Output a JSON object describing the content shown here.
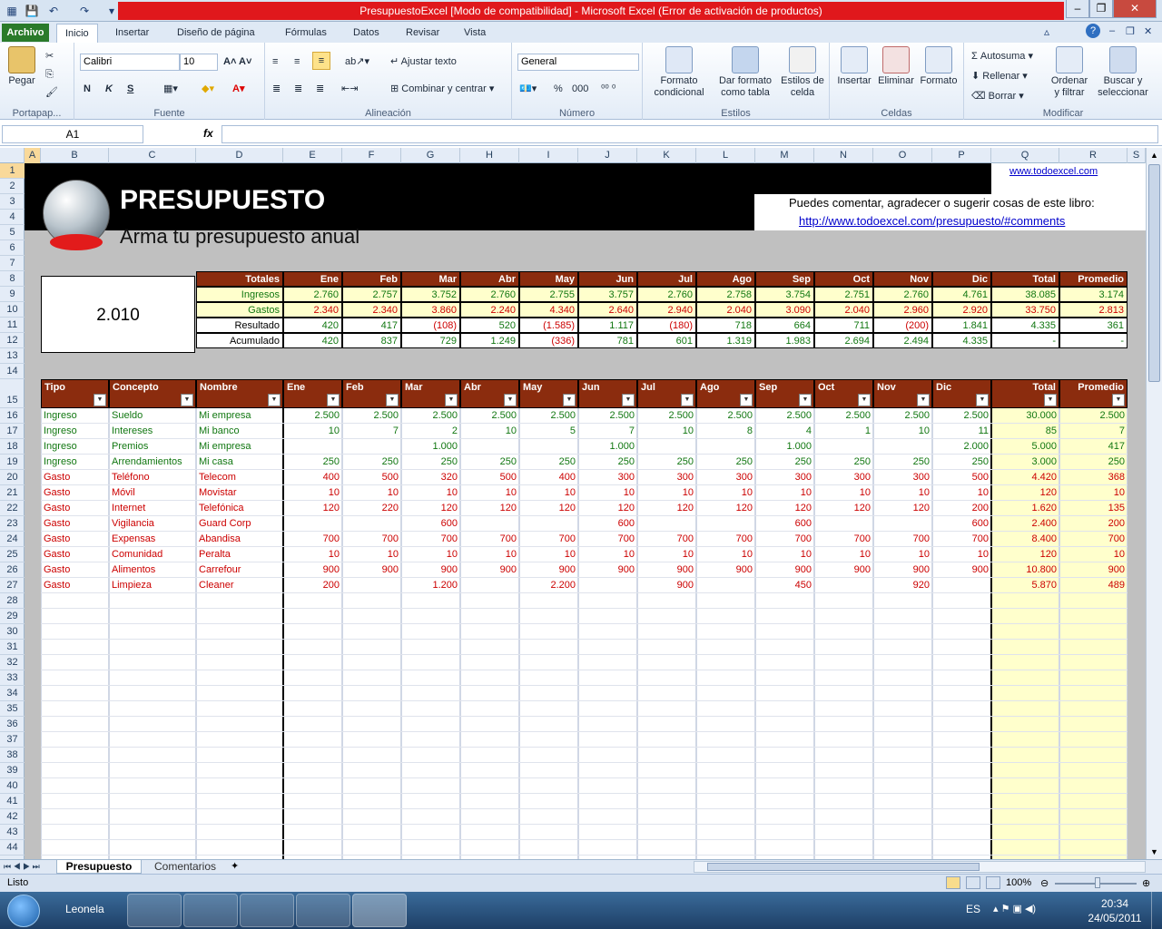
{
  "window": {
    "title": "PresupuestoExcel  [Modo de compatibilidad]  -  Microsoft Excel (Error de activación de productos)"
  },
  "tabs": {
    "archivo": "Archivo",
    "items": [
      "Inicio",
      "Insertar",
      "Diseño de página",
      "Fórmulas",
      "Datos",
      "Revisar",
      "Vista"
    ]
  },
  "ribbon": {
    "portapapeles": {
      "label": "Portapap...",
      "pegar": "Pegar"
    },
    "fuente": {
      "label": "Fuente",
      "font": "Calibri",
      "size": "10",
      "bold": "N",
      "italic": "K",
      "underline": "S"
    },
    "alineacion": {
      "label": "Alineación",
      "wrap": "Ajustar texto",
      "merge": "Combinar y centrar"
    },
    "numero": {
      "label": "Número",
      "format": "General",
      "percent": "%",
      "thousands": "000"
    },
    "estilos": {
      "label": "Estilos",
      "cond1": "Formato",
      "cond2": "condicional",
      "table1": "Dar formato",
      "table2": "como tabla",
      "cell1": "Estilos de",
      "cell2": "celda"
    },
    "celdas": {
      "label": "Celdas",
      "insert": "Insertar",
      "delete": "Eliminar",
      "format": "Formato"
    },
    "modificar": {
      "label": "Modificar",
      "autosum": "Autosuma",
      "fill": "Rellenar",
      "clear": "Borrar",
      "sort1": "Ordenar",
      "sort2": "y filtrar",
      "find1": "Buscar y",
      "find2": "seleccionar"
    }
  },
  "formula": {
    "namebox": "A1",
    "fx": "fx",
    "value": ""
  },
  "columns": [
    "A",
    "B",
    "C",
    "D",
    "E",
    "F",
    "G",
    "H",
    "I",
    "J",
    "K",
    "L",
    "M",
    "N",
    "O",
    "P",
    "Q",
    "R",
    "S"
  ],
  "rows": [
    "1",
    "2",
    "3",
    "4",
    "5",
    "6",
    "7",
    "8",
    "9",
    "10",
    "11",
    "12",
    "13",
    "14",
    "15",
    "16",
    "17",
    "18",
    "19",
    "20",
    "21",
    "22",
    "23",
    "24",
    "25",
    "26",
    "27",
    "28",
    "29",
    "30",
    "31",
    "32",
    "33",
    "34",
    "35",
    "36",
    "37",
    "38",
    "39",
    "40",
    "41",
    "42",
    "43",
    "44"
  ],
  "sheet": {
    "title": "PRESUPUESTO",
    "subtitle": "Arma tu presupuesto anual",
    "site": "www.todoexcel.com",
    "comment": "Puedes comentar, agradecer o sugerir cosas de este libro:",
    "comment_link": "http://www.todoexcel.com/presupuesto/#comments",
    "year": "2.010",
    "summary_headers": [
      "Totales",
      "Ene",
      "Feb",
      "Mar",
      "Abr",
      "May",
      "Jun",
      "Jul",
      "Ago",
      "Sep",
      "Oct",
      "Nov",
      "Dic",
      "Total",
      "Promedio"
    ],
    "summary_rows": [
      [
        "Ingresos",
        "2.760",
        "2.757",
        "3.752",
        "2.760",
        "2.755",
        "3.757",
        "2.760",
        "2.758",
        "3.754",
        "2.751",
        "2.760",
        "4.761",
        "38.085",
        "3.174"
      ],
      [
        "Gastos",
        "2.340",
        "2.340",
        "3.860",
        "2.240",
        "4.340",
        "2.640",
        "2.940",
        "2.040",
        "3.090",
        "2.040",
        "2.960",
        "2.920",
        "33.750",
        "2.813"
      ],
      [
        "Resultado",
        "420",
        "417",
        "(108)",
        "520",
        "(1.585)",
        "1.117",
        "(180)",
        "718",
        "664",
        "711",
        "(200)",
        "1.841",
        "4.335",
        "361"
      ],
      [
        "Acumulado",
        "420",
        "837",
        "729",
        "1.249",
        "(336)",
        "781",
        "601",
        "1.319",
        "1.983",
        "2.694",
        "2.494",
        "4.335",
        "-",
        "-"
      ]
    ],
    "detail_headers": [
      "Tipo",
      "Concepto",
      "Nombre",
      "Ene",
      "Feb",
      "Mar",
      "Abr",
      "May",
      "Jun",
      "Jul",
      "Ago",
      "Sep",
      "Oct",
      "Nov",
      "Dic",
      "Total",
      "Promedio"
    ],
    "detail_rows": [
      [
        "Ingreso",
        "Sueldo",
        "Mi empresa",
        "2.500",
        "2.500",
        "2.500",
        "2.500",
        "2.500",
        "2.500",
        "2.500",
        "2.500",
        "2.500",
        "2.500",
        "2.500",
        "2.500",
        "30.000",
        "2.500"
      ],
      [
        "Ingreso",
        "Intereses",
        "Mi banco",
        "10",
        "7",
        "2",
        "10",
        "5",
        "7",
        "10",
        "8",
        "4",
        "1",
        "10",
        "11",
        "85",
        "7"
      ],
      [
        "Ingreso",
        "Premios",
        "Mi empresa",
        "",
        "",
        "1.000",
        "",
        "",
        "1.000",
        "",
        "",
        "1.000",
        "",
        "",
        "2.000",
        "5.000",
        "417"
      ],
      [
        "Ingreso",
        "Arrendamientos",
        "Mi casa",
        "250",
        "250",
        "250",
        "250",
        "250",
        "250",
        "250",
        "250",
        "250",
        "250",
        "250",
        "250",
        "3.000",
        "250"
      ],
      [
        "Gasto",
        "Teléfono",
        "Telecom",
        "400",
        "500",
        "320",
        "500",
        "400",
        "300",
        "300",
        "300",
        "300",
        "300",
        "300",
        "500",
        "4.420",
        "368"
      ],
      [
        "Gasto",
        "Móvil",
        "Movistar",
        "10",
        "10",
        "10",
        "10",
        "10",
        "10",
        "10",
        "10",
        "10",
        "10",
        "10",
        "10",
        "120",
        "10"
      ],
      [
        "Gasto",
        "Internet",
        "Telefónica",
        "120",
        "220",
        "120",
        "120",
        "120",
        "120",
        "120",
        "120",
        "120",
        "120",
        "120",
        "200",
        "1.620",
        "135"
      ],
      [
        "Gasto",
        "Vigilancia",
        "Guard Corp",
        "",
        "",
        "600",
        "",
        "",
        "600",
        "",
        "",
        "600",
        "",
        "",
        "600",
        "2.400",
        "200"
      ],
      [
        "Gasto",
        "Expensas",
        "Abandisa",
        "700",
        "700",
        "700",
        "700",
        "700",
        "700",
        "700",
        "700",
        "700",
        "700",
        "700",
        "700",
        "8.400",
        "700"
      ],
      [
        "Gasto",
        "Comunidad",
        "Peralta",
        "10",
        "10",
        "10",
        "10",
        "10",
        "10",
        "10",
        "10",
        "10",
        "10",
        "10",
        "10",
        "120",
        "10"
      ],
      [
        "Gasto",
        "Alimentos",
        "Carrefour",
        "900",
        "900",
        "900",
        "900",
        "900",
        "900",
        "900",
        "900",
        "900",
        "900",
        "900",
        "900",
        "10.800",
        "900"
      ],
      [
        "Gasto",
        "Limpieza",
        "Cleaner",
        "200",
        "",
        "1.200",
        "",
        "2.200",
        "",
        "900",
        "",
        "450",
        "",
        "920",
        "",
        "5.870",
        "489"
      ]
    ]
  },
  "sheettabs": [
    "Presupuesto",
    "Comentarios"
  ],
  "status": {
    "ready": "Listo",
    "zoom": "100%"
  },
  "taskbar": {
    "user": "Leonela",
    "lang": "ES",
    "time": "20:34",
    "date": "24/05/2011"
  }
}
